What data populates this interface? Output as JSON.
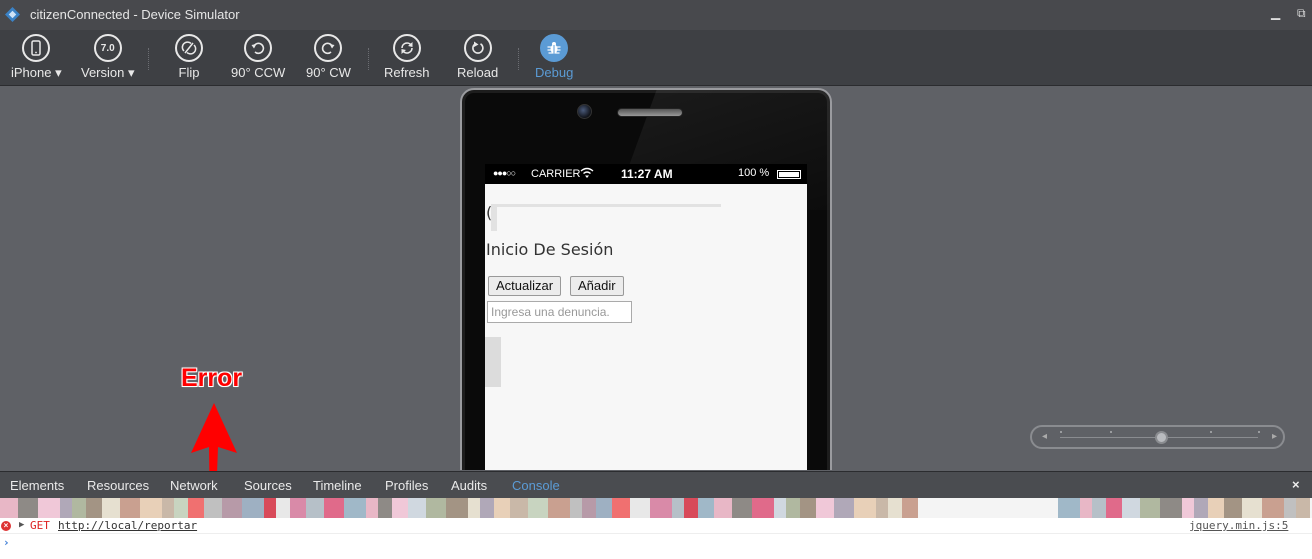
{
  "window": {
    "title": "citizenConnected - Device Simulator",
    "minimize": "▁",
    "restore": "⧉"
  },
  "toolbar": {
    "device": "iPhone ▾",
    "version_badge": "7.0",
    "version": "Version ▾",
    "flip": "Flip",
    "rotate_ccw": "90° CCW",
    "rotate_cw": "90° CW",
    "refresh": "Refresh",
    "reload": "Reload",
    "debug": "Debug"
  },
  "statusbar": {
    "signal": "●●●○○",
    "carrier": "CARRIER",
    "time": "11:27 AM",
    "battery": "100 %"
  },
  "app": {
    "paren": "(",
    "title": "Inicio De Sesión",
    "update_button": "Actualizar",
    "add_button": "Añadir",
    "report_placeholder": "Ingresa una denuncia."
  },
  "annotation": {
    "label": "Error",
    "color": "#ff0000"
  },
  "devtools": {
    "tabs": [
      "Elements",
      "Resources",
      "Network",
      "Sources",
      "Timeline",
      "Profiles",
      "Audits",
      "Console"
    ],
    "active_tab": "Console",
    "close": "×"
  },
  "console": {
    "error_icon": "×",
    "expand": "▶",
    "method": "GET",
    "url": "http://local/reportar",
    "source": "jquery.min.js:5",
    "prompt": "›"
  },
  "colors": {
    "accent": "#5b9bd5",
    "error": "#dd2222"
  }
}
